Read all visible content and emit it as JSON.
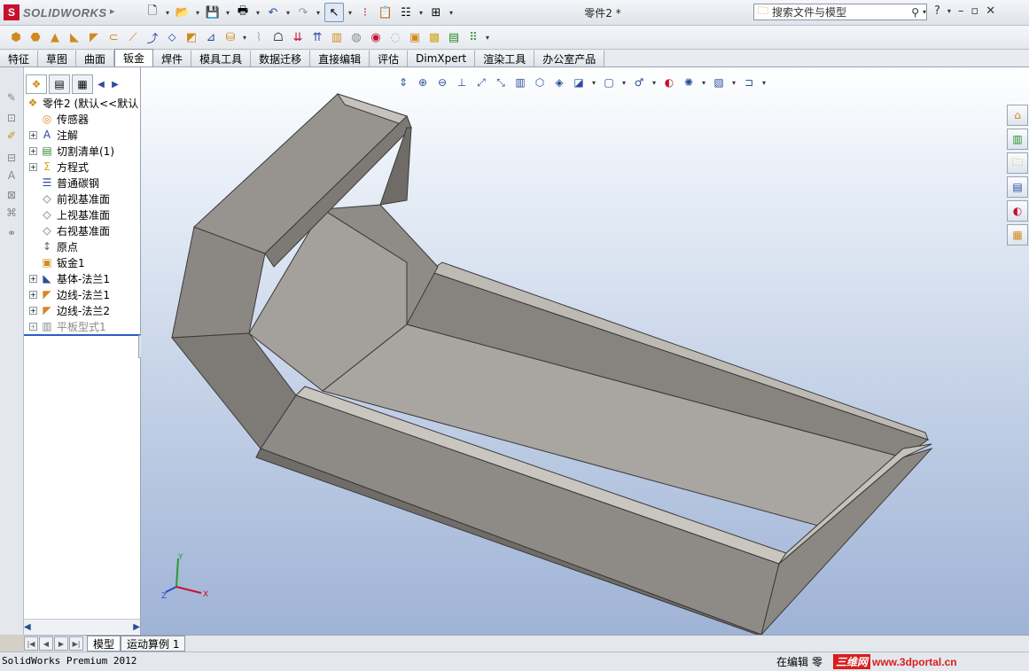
{
  "app": {
    "logo_text": "SOLIDWORKS",
    "document_title": "零件2 *",
    "search_placeholder": "搜索文件与模型"
  },
  "tabs": [
    "特征",
    "草图",
    "曲面",
    "钣金",
    "焊件",
    "模具工具",
    "数据迁移",
    "直接编辑",
    "评估",
    "DimXpert",
    "渲染工具",
    "办公室产品"
  ],
  "active_tab": "钣金",
  "feature_tree": {
    "root": "零件2  (默认<<默认",
    "items": [
      {
        "label": "传感器",
        "expand": false
      },
      {
        "label": "注解",
        "expand": true
      },
      {
        "label": "切割清单(1)",
        "expand": true
      },
      {
        "label": "方程式",
        "expand": true
      },
      {
        "label": "普通碳钢",
        "expand": false
      },
      {
        "label": "前视基准面",
        "expand": false
      },
      {
        "label": "上视基准面",
        "expand": false
      },
      {
        "label": "右视基准面",
        "expand": false
      },
      {
        "label": "原点",
        "expand": false
      },
      {
        "label": "钣金1",
        "expand": false
      },
      {
        "label": "基体-法兰1",
        "expand": true
      },
      {
        "label": "边线-法兰1",
        "expand": true
      },
      {
        "label": "边线-法兰2",
        "expand": true
      },
      {
        "label": "平板型式1",
        "expand": true
      }
    ]
  },
  "triad": {
    "x": "X",
    "y": "Y",
    "z": "Z"
  },
  "bottom_tabs": [
    "模型",
    "运动算例 1"
  ],
  "status": {
    "left": "SolidWorks Premium 2012",
    "right_edit": "在编辑",
    "right_doc": "零"
  },
  "watermark": {
    "cn": "三维网",
    "url": "www.3dportal.cn"
  },
  "colors": {
    "model_face": "#8e8b87",
    "model_light": "#c9c6c0",
    "model_dark": "#6e6b67",
    "viewport_bottom": "#9fb3d6",
    "accent": "#2a5cc8"
  }
}
